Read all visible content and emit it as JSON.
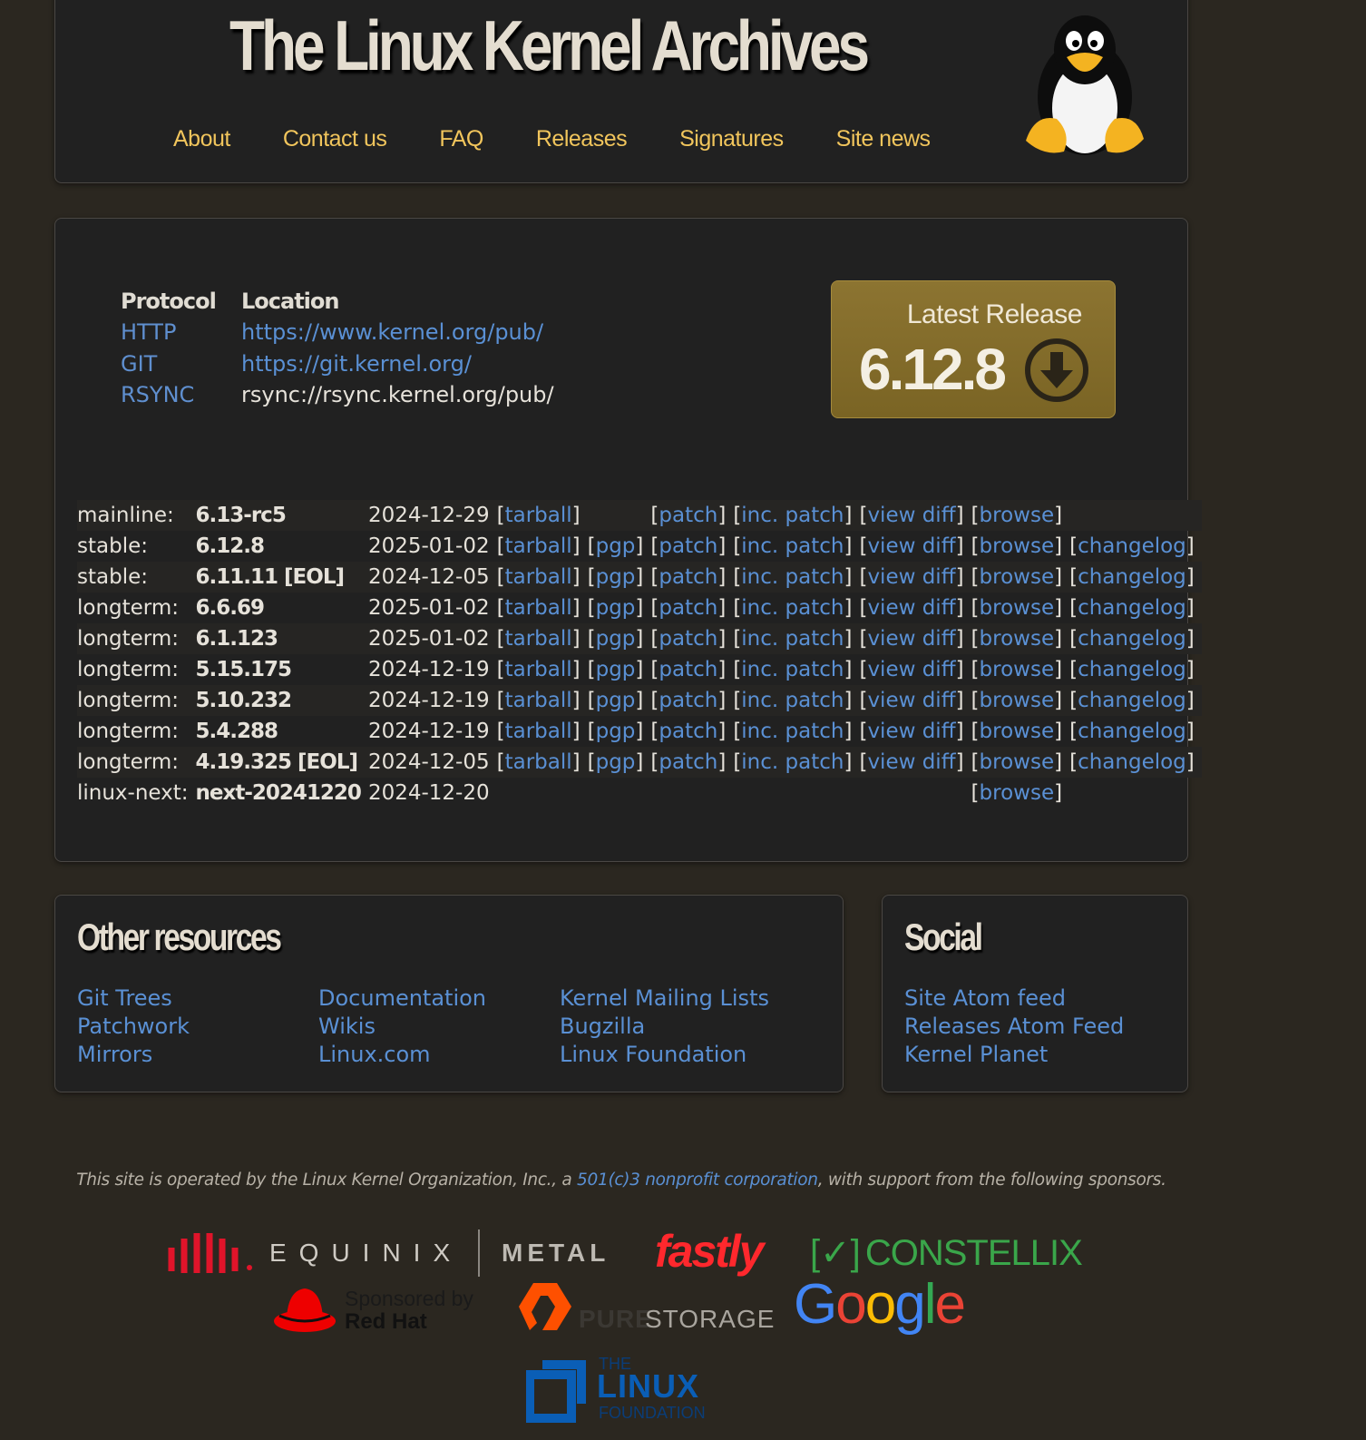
{
  "header": {
    "title": "The Linux Kernel Archives",
    "nav": [
      "About",
      "Contact us",
      "FAQ",
      "Releases",
      "Signatures",
      "Site news"
    ]
  },
  "protocols": {
    "header_protocol": "Protocol",
    "header_location": "Location",
    "rows": [
      {
        "name": "HTTP",
        "location": "https://www.kernel.org/pub/"
      },
      {
        "name": "GIT",
        "location": "https://git.kernel.org/"
      },
      {
        "name": "RSYNC",
        "location": "rsync://rsync.kernel.org/pub/"
      }
    ]
  },
  "latest_release": {
    "label": "Latest Release",
    "version": "6.12.8",
    "colors": {
      "bg": "#84702d",
      "icon": "#2a2418"
    }
  },
  "releases": [
    {
      "type": "mainline:",
      "version": "6.13-rc5",
      "date": "2024-12-29",
      "links": [
        "tarball",
        "",
        "patch",
        "inc. patch",
        "view diff",
        "browse",
        ""
      ]
    },
    {
      "type": "stable:",
      "version": "6.12.8",
      "date": "2025-01-02",
      "links": [
        "tarball",
        "pgp",
        "patch",
        "inc. patch",
        "view diff",
        "browse",
        "changelog"
      ]
    },
    {
      "type": "stable:",
      "version": "6.11.11 [EOL]",
      "date": "2024-12-05",
      "links": [
        "tarball",
        "pgp",
        "patch",
        "inc. patch",
        "view diff",
        "browse",
        "changelog"
      ]
    },
    {
      "type": "longterm:",
      "version": "6.6.69",
      "date": "2025-01-02",
      "links": [
        "tarball",
        "pgp",
        "patch",
        "inc. patch",
        "view diff",
        "browse",
        "changelog"
      ]
    },
    {
      "type": "longterm:",
      "version": "6.1.123",
      "date": "2025-01-02",
      "links": [
        "tarball",
        "pgp",
        "patch",
        "inc. patch",
        "view diff",
        "browse",
        "changelog"
      ]
    },
    {
      "type": "longterm:",
      "version": "5.15.175",
      "date": "2024-12-19",
      "links": [
        "tarball",
        "pgp",
        "patch",
        "inc. patch",
        "view diff",
        "browse",
        "changelog"
      ]
    },
    {
      "type": "longterm:",
      "version": "5.10.232",
      "date": "2024-12-19",
      "links": [
        "tarball",
        "pgp",
        "patch",
        "inc. patch",
        "view diff",
        "browse",
        "changelog"
      ]
    },
    {
      "type": "longterm:",
      "version": "5.4.288",
      "date": "2024-12-19",
      "links": [
        "tarball",
        "pgp",
        "patch",
        "inc. patch",
        "view diff",
        "browse",
        "changelog"
      ]
    },
    {
      "type": "longterm:",
      "version": "4.19.325 [EOL]",
      "date": "2024-12-05",
      "links": [
        "tarball",
        "pgp",
        "patch",
        "inc. patch",
        "view diff",
        "browse",
        "changelog"
      ]
    },
    {
      "type": "linux-next:",
      "version": "next-20241220",
      "date": "2024-12-20",
      "links": [
        "",
        "",
        "",
        "",
        "",
        "browse",
        ""
      ]
    }
  ],
  "other_resources": {
    "title": "Other resources",
    "col1": [
      "Git Trees",
      "Patchwork",
      "Mirrors"
    ],
    "col2": [
      "Documentation",
      "Wikis",
      "Linux.com"
    ],
    "col3": [
      "Kernel Mailing Lists",
      "Bugzilla",
      "Linux Foundation"
    ]
  },
  "social": {
    "title": "Social",
    "links": [
      "Site Atom feed",
      "Releases Atom Feed",
      "Kernel Planet"
    ]
  },
  "footer": {
    "text_before": "This site is operated by the Linux Kernel Organization, Inc., a ",
    "link": "501(c)3 nonprofit corporation",
    "text_after": ", with support from the following sponsors."
  },
  "sponsors": {
    "equinix_word": "EQUINIX",
    "metal_word": "METAL",
    "fastly_word": "fastly",
    "constellix_word": "CONSTELLIX",
    "constellix_mark": "[✓]",
    "redhat_line1": "Sponsored by",
    "redhat_line2": "Red Hat",
    "pure_word": "PURE",
    "storage_word": "STORAGE",
    "google_letters": [
      "G",
      "o",
      "o",
      "g",
      "l",
      "e"
    ],
    "lf_line1": "THE",
    "lf_line2": "LINUX",
    "lf_line3": "FOUNDATION",
    "colors": {
      "link": "#5a90d4",
      "nav": "#f1c55c",
      "equinix_red": "#e0142a",
      "fastly_red": "#ff282d",
      "constellix_green": "#3aa64a",
      "google": [
        "#4285f4",
        "#ea4335",
        "#fbbc05",
        "#4285f4",
        "#34a853",
        "#ea4335"
      ],
      "lf_blue": "#0a5eb6"
    }
  }
}
